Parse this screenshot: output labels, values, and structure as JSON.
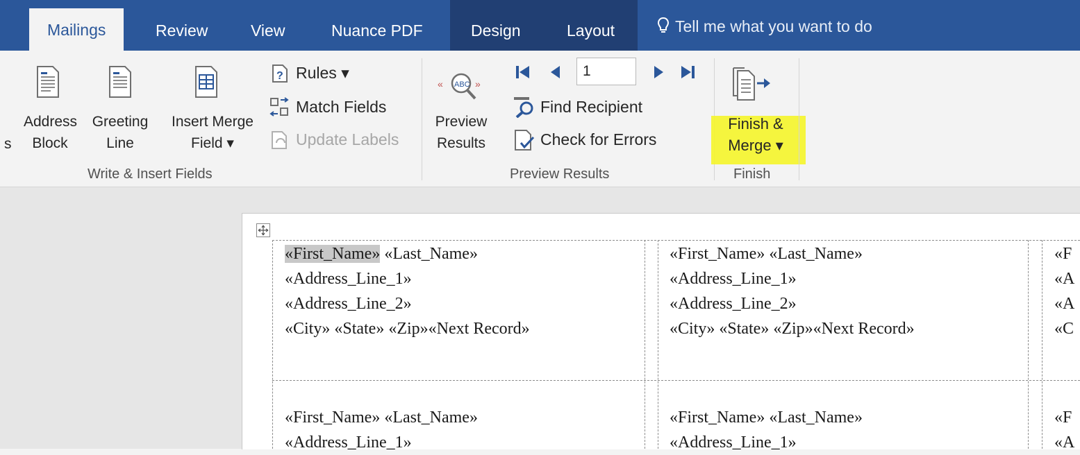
{
  "tabs": {
    "mailings": "Mailings",
    "review": "Review",
    "view": "View",
    "nuance_pdf": "Nuance PDF",
    "design": "Design",
    "layout": "Layout"
  },
  "tell_me": "Tell me what you want to do",
  "write_insert": {
    "cut_label": "s",
    "address_block": [
      "Address",
      "Block"
    ],
    "greeting_line": [
      "Greeting",
      "Line"
    ],
    "insert_merge_field": [
      "Insert Merge",
      "Field ▾"
    ],
    "rules": "Rules ▾",
    "match_fields": "Match Fields",
    "update_labels": "Update Labels",
    "group_label": "Write & Insert Fields"
  },
  "preview": {
    "preview_results": [
      "Preview",
      "Results"
    ],
    "record_number": "1",
    "find_recipient": "Find Recipient",
    "check_errors": "Check for Errors",
    "group_label": "Preview Results"
  },
  "finish": {
    "finish_merge": [
      "Finish &",
      "Merge ▾"
    ],
    "group_label": "Finish"
  },
  "labels": {
    "cell_1": [
      "«First_Name»",
      " «Last_Name»",
      "«Address_Line_1»",
      "«Address_Line_2»",
      "«City» «State» «Zip»«Next Record»"
    ],
    "cell_2": [
      "«First_Name» «Last_Name»",
      "«Address_Line_1»",
      "«Address_Line_2»",
      "«City» «State» «Zip»«Next Record»"
    ],
    "cell_3": [
      "«F",
      "«A",
      "«A",
      "«C"
    ],
    "cell_4": [
      "«First_Name» «Last_Name»",
      "«Address_Line_1»"
    ],
    "cell_5": [
      "«First_Name» «Last_Name»",
      "«Address_Line_1»"
    ],
    "cell_6": [
      "«F",
      "«A"
    ]
  },
  "colors": {
    "ribbon_blue": "#2b579a",
    "contextual_tab": "#213f73",
    "highlight": "#f5f52a"
  }
}
